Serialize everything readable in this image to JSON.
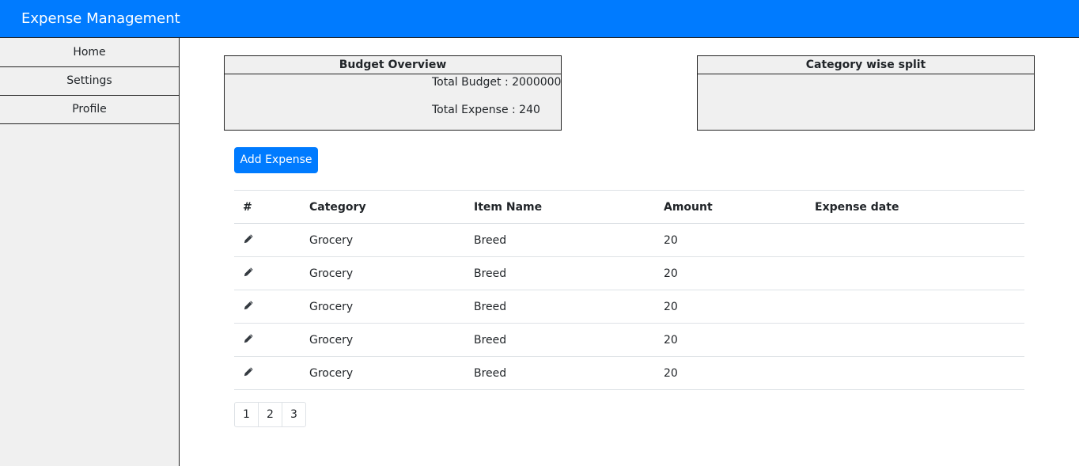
{
  "app": {
    "title": "Expense Management"
  },
  "sidebar": {
    "items": [
      {
        "label": "Home"
      },
      {
        "label": "Settings"
      },
      {
        "label": "Profile"
      }
    ]
  },
  "budget_overview": {
    "title": "Budget Overview",
    "total_budget": "Total Budget : 2000000",
    "total_expense": "Total Expense : 240"
  },
  "category_split": {
    "title": "Category wise split"
  },
  "actions": {
    "add_expense": "Add Expense"
  },
  "table": {
    "headers": [
      "#",
      "Category",
      "Item Name",
      "Amount",
      "Expense date"
    ],
    "rows": [
      {
        "icon": "edit-icon",
        "category": "Grocery",
        "item": "Breed",
        "amount": "20",
        "date": ""
      },
      {
        "icon": "edit-icon",
        "category": "Grocery",
        "item": "Breed",
        "amount": "20",
        "date": ""
      },
      {
        "icon": "edit-icon",
        "category": "Grocery",
        "item": "Breed",
        "amount": "20",
        "date": ""
      },
      {
        "icon": "edit-icon",
        "category": "Grocery",
        "item": "Breed",
        "amount": "20",
        "date": ""
      },
      {
        "icon": "edit-icon",
        "category": "Grocery",
        "item": "Breed",
        "amount": "20",
        "date": ""
      }
    ]
  },
  "pagination": {
    "pages": [
      "1",
      "2",
      "3"
    ]
  },
  "colors": {
    "primary": "#007bff",
    "panel_bg": "#f0f0f0",
    "border": "#222222"
  }
}
